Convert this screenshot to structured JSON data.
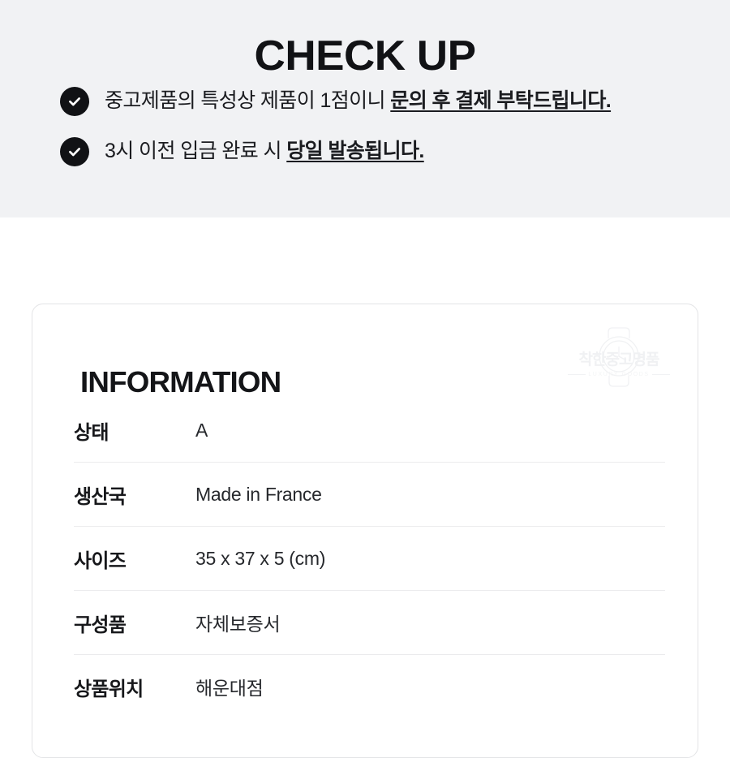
{
  "checkup": {
    "title": "CHECK UP",
    "items": [
      {
        "icon": "check-circle-icon",
        "text_plain": "중고제품의 특성상 제품이 1점이니 ",
        "text_emphasis": "문의 후 결제 부탁드립니다."
      },
      {
        "icon": "check-circle-icon",
        "text_plain": "3시 이전 입금 완료 시 ",
        "text_emphasis": "당일 발송됩니다."
      }
    ]
  },
  "information": {
    "heading": "INFORMATION",
    "watermark": {
      "icon": "watch-outline-icon",
      "brand": "착한중고명품",
      "subtitle": "LUXURY GOODS"
    },
    "rows": [
      {
        "label": "상태",
        "value": "A"
      },
      {
        "label": "생산국",
        "value": "Made in France"
      },
      {
        "label": "사이즈",
        "value": "35 x 37 x 5 (cm)"
      },
      {
        "label": "구성품",
        "value": "자체보증서"
      },
      {
        "label": "상품위치",
        "value": "해운대점"
      }
    ]
  },
  "colors": {
    "banner_background": "#f1f2f4",
    "page_background": "#ffffff",
    "badge": "#111215",
    "text": "#17181b",
    "divider": "#ebebed",
    "card_border": "#e3e4e6"
  }
}
